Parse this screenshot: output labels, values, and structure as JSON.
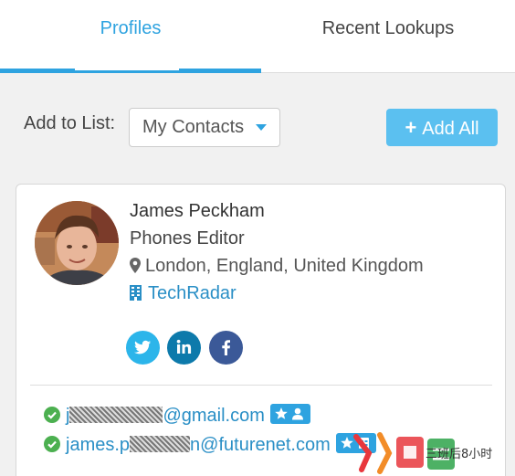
{
  "tabs": {
    "profiles": "Profiles",
    "recent": "Recent Lookups"
  },
  "toolbar": {
    "add_to_list_label": "Add to List:",
    "selected_list": "My Contacts",
    "add_all_label": "Add All"
  },
  "profile": {
    "name": "James Peckham",
    "title": "Phones Editor",
    "location": "London, England, United Kingdom",
    "company": "TechRadar",
    "social": [
      "twitter-icon",
      "linkedin-icon",
      "facebook-icon"
    ]
  },
  "emails": [
    {
      "prefix": "j",
      "suffix": "@gmail.com"
    },
    {
      "prefix": "james.p",
      "suffix": "n@futurenet.com"
    }
  ],
  "watermark": {
    "text": "三班后8小时"
  },
  "colors": {
    "accent": "#2ea3e0",
    "button": "#5bc0f0",
    "verified": "#4cb050",
    "link": "#2a8fc6"
  }
}
